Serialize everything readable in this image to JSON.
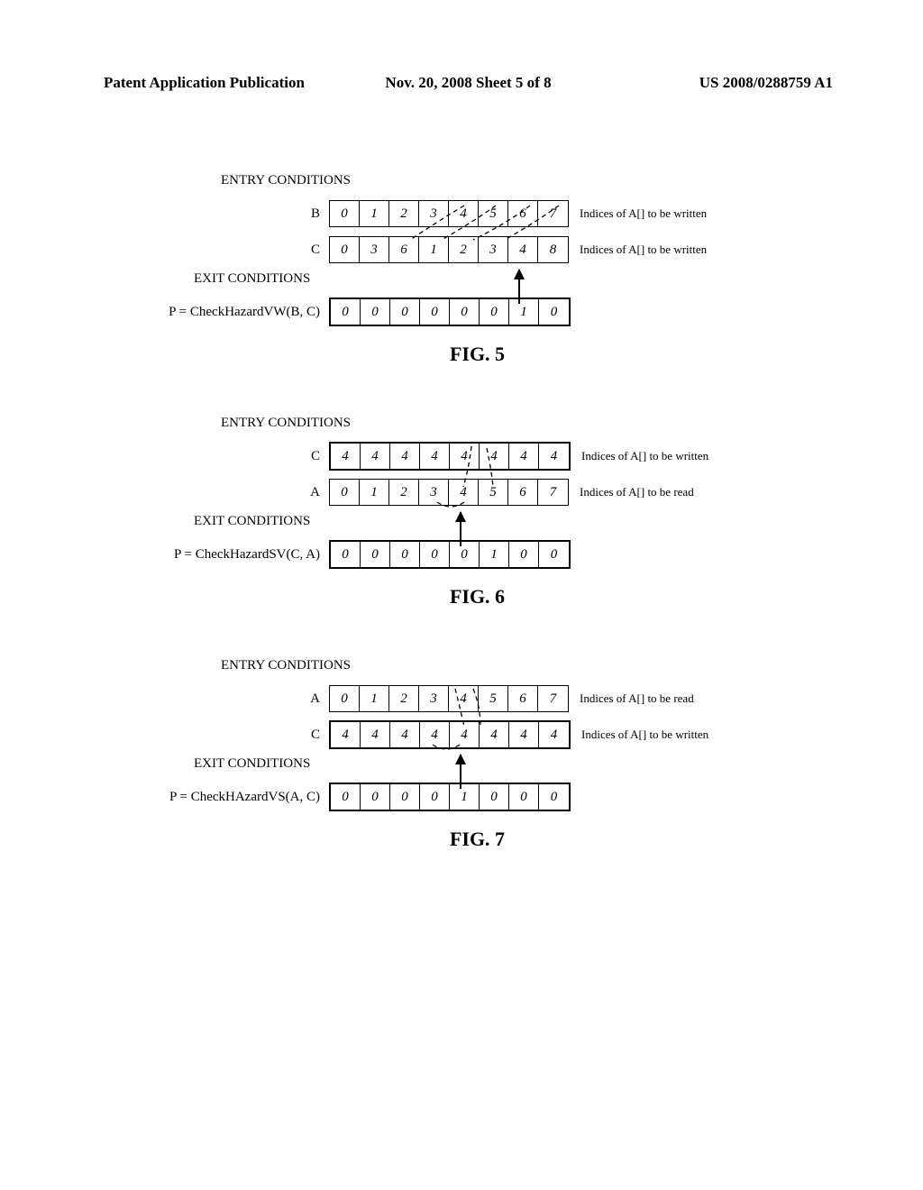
{
  "header": {
    "left": "Patent Application Publication",
    "mid": "Nov. 20, 2008  Sheet 5 of 8",
    "right": "US 2008/0288759 A1"
  },
  "fig5": {
    "entry_label": "ENTRY CONDITIONS",
    "exit_label": "EXIT CONDITIONS",
    "caption": "FIG. 5",
    "rowB": {
      "label": "B",
      "cells": [
        "0",
        "1",
        "2",
        "3",
        "4",
        "5",
        "6",
        "7"
      ],
      "note": "Indices of A[] to be written"
    },
    "rowC": {
      "label": "C",
      "cells": [
        "0",
        "3",
        "6",
        "1",
        "2",
        "3",
        "4",
        "8"
      ],
      "note": "Indices of A[] to be written"
    },
    "rowP": {
      "label": "P = CheckHazardVW(B, C)",
      "cells": [
        "0",
        "0",
        "0",
        "0",
        "0",
        "0",
        "1",
        "0"
      ]
    }
  },
  "fig6": {
    "entry_label": "ENTRY CONDITIONS",
    "exit_label": "EXIT CONDITIONS",
    "caption": "FIG. 6",
    "rowC": {
      "label": "C",
      "cells": [
        "4",
        "4",
        "4",
        "4",
        "4",
        "4",
        "4",
        "4"
      ],
      "note": "Indices of A[] to be written"
    },
    "rowA": {
      "label": "A",
      "cells": [
        "0",
        "1",
        "2",
        "3",
        "4",
        "5",
        "6",
        "7"
      ],
      "note": "Indices of A[] to be read"
    },
    "rowP": {
      "label": "P = CheckHazardSV(C, A)",
      "cells": [
        "0",
        "0",
        "0",
        "0",
        "0",
        "1",
        "0",
        "0"
      ]
    }
  },
  "fig7": {
    "entry_label": "ENTRY CONDITIONS",
    "exit_label": "EXIT CONDITIONS",
    "caption": "FIG. 7",
    "rowA": {
      "label": "A",
      "cells": [
        "0",
        "1",
        "2",
        "3",
        "4",
        "5",
        "6",
        "7"
      ],
      "note": "Indices of A[] to be read"
    },
    "rowC": {
      "label": "C",
      "cells": [
        "4",
        "4",
        "4",
        "4",
        "4",
        "4",
        "4",
        "4"
      ],
      "note": "Indices of A[] to be written"
    },
    "rowP": {
      "label": "P = CheckHAzardVS(A, C)",
      "cells": [
        "0",
        "0",
        "0",
        "0",
        "1",
        "0",
        "0",
        "0"
      ]
    }
  },
  "chart_data": [
    {
      "type": "table",
      "title": "FIG. 5 — CheckHazardVW(B, C)",
      "rows": [
        {
          "name": "B",
          "values": [
            0,
            1,
            2,
            3,
            4,
            5,
            6,
            7
          ],
          "desc": "Indices of A[] to be written"
        },
        {
          "name": "C",
          "values": [
            0,
            3,
            6,
            1,
            2,
            3,
            4,
            8
          ],
          "desc": "Indices of A[] to be written"
        },
        {
          "name": "P",
          "values": [
            0,
            0,
            0,
            0,
            0,
            0,
            1,
            0
          ],
          "desc": "CheckHazardVW(B, C)"
        }
      ],
      "hazard_index": 6
    },
    {
      "type": "table",
      "title": "FIG. 6 — CheckHazardSV(C, A)",
      "rows": [
        {
          "name": "C",
          "values": [
            4,
            4,
            4,
            4,
            4,
            4,
            4,
            4
          ],
          "desc": "Indices of A[] to be written"
        },
        {
          "name": "A",
          "values": [
            0,
            1,
            2,
            3,
            4,
            5,
            6,
            7
          ],
          "desc": "Indices of A[] to be read"
        },
        {
          "name": "P",
          "values": [
            0,
            0,
            0,
            0,
            0,
            1,
            0,
            0
          ],
          "desc": "CheckHazardSV(C, A)"
        }
      ],
      "hazard_index": 5
    },
    {
      "type": "table",
      "title": "FIG. 7 — CheckHAzardVS(A, C)",
      "rows": [
        {
          "name": "A",
          "values": [
            0,
            1,
            2,
            3,
            4,
            5,
            6,
            7
          ],
          "desc": "Indices of A[] to be read"
        },
        {
          "name": "C",
          "values": [
            4,
            4,
            4,
            4,
            4,
            4,
            4,
            4
          ],
          "desc": "Indices of A[] to be written"
        },
        {
          "name": "P",
          "values": [
            0,
            0,
            0,
            0,
            1,
            0,
            0,
            0
          ],
          "desc": "CheckHAzardVS(A, C)"
        }
      ],
      "hazard_index": 4
    }
  ]
}
